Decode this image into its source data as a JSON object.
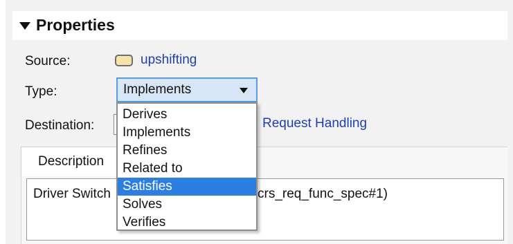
{
  "properties": {
    "title": "Properties",
    "source_label": "Source:",
    "source_value": "upshifting",
    "type_label": "Type:",
    "type_value": "Implements",
    "destination_label": "Destination:",
    "destination_value": "Request Handling",
    "tab_description": "Description",
    "description_left": "Driver Switch",
    "description_right": "crs_req_func_spec#1)"
  },
  "type_dropdown": {
    "options": [
      "Derives",
      "Implements",
      "Refines",
      "Related to",
      "Satisfies",
      "Solves",
      "Verifies"
    ],
    "highlighted": "Satisfies"
  },
  "colors": {
    "link": "#1d3fb0",
    "highlight": "#2c7ee0",
    "select_bg": "#d7e6f7",
    "select_border": "#5a9bdc"
  },
  "icons": {
    "collapse": "triangle-down-icon",
    "source": "requirement-icon",
    "dropdown": "caret-down-icon"
  }
}
